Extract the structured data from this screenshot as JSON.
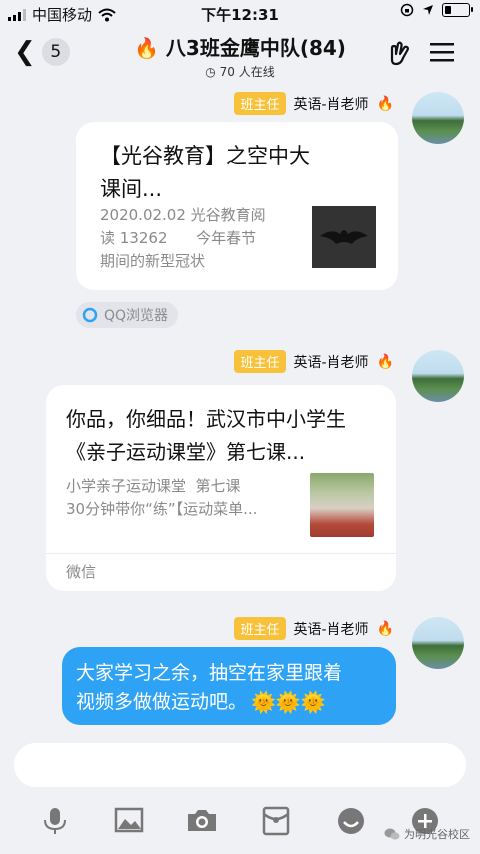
{
  "status": {
    "carrier": "中国移动",
    "time": "下午12:31"
  },
  "nav": {
    "back_count": "5",
    "title": "八3班金鹰中队(84)",
    "online": "70 人在线"
  },
  "messages": [
    {
      "badge": "班主任",
      "sender": "英语-肖老师",
      "title_line1": "【光谷教育】之空中大",
      "title_line2": "课间...",
      "desc_line1": "2020.02.02 光谷教育阅",
      "desc_line2": "读 13262      今年春节",
      "desc_line3": "期间的新型冠状",
      "source": "QQ浏览器"
    },
    {
      "badge": "班主任",
      "sender": "英语-肖老师",
      "title_line1": "你品，你细品！武汉市中小学生",
      "title_line2": "《亲子运动课堂》第七课...",
      "desc_line1": "小学亲子运动课堂  第七课",
      "desc_line2": "30分钟带你“练”【运动菜单...",
      "source": "微信"
    },
    {
      "badge": "班主任",
      "sender": "英语-肖老师",
      "text_line1": "大家学习之余，抽空在家里跟着",
      "text_line2": "视频多做做运动吧。"
    }
  ],
  "watermark": "为明光谷校区",
  "colors": {
    "accent": "#2ea3f5",
    "badge": "#f7c23a",
    "background": "#f0f1f5"
  },
  "icons": [
    "signal-icon",
    "wifi-icon",
    "lock-rotation-icon",
    "location-icon",
    "battery-icon",
    "back-chevron-icon",
    "fire-icon",
    "clock-icon",
    "hand-gesture-icon",
    "menu-icon",
    "voice-icon",
    "image-icon",
    "camera-icon",
    "red-packet-icon",
    "emoji-icon",
    "plus-icon",
    "wechat-icon"
  ]
}
